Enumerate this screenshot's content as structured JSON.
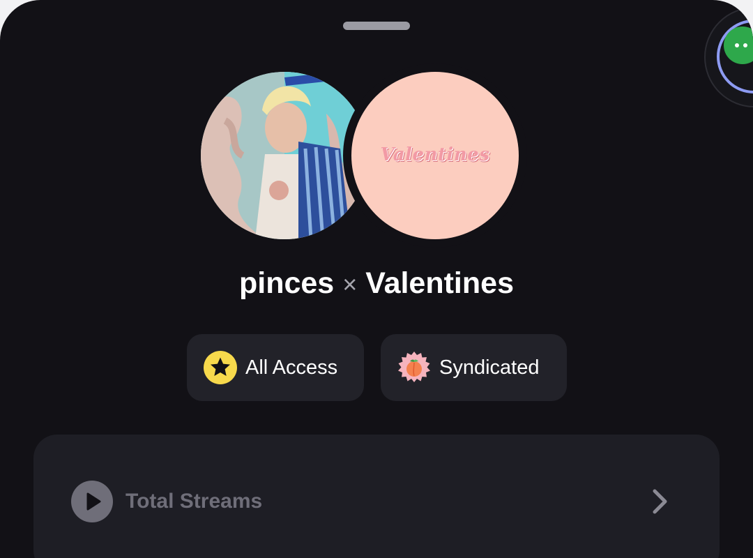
{
  "header": {
    "artist_name": "pinces",
    "separator": "×",
    "label_name": "Valentines"
  },
  "avatars": {
    "label_logo_text": "Valentines"
  },
  "badges": [
    {
      "label": "All Access",
      "icon": "star-badge-icon"
    },
    {
      "label": "Syndicated",
      "icon": "peach-badge-icon"
    }
  ],
  "stats": {
    "total_streams_label": "Total Streams",
    "icon": "play-icon"
  },
  "colors": {
    "background": "#121116",
    "card": "#1e1e25",
    "badge": "#222229",
    "star_badge": "#f7d94c",
    "assistant_ring": "#8d9bf2",
    "assistant_core": "#2ea84b"
  }
}
